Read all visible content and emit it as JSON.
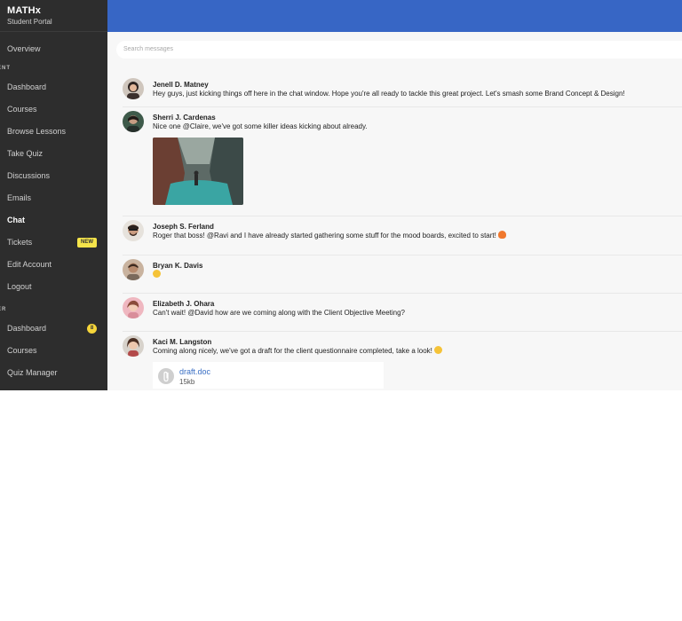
{
  "brand": {
    "name": "MATHx",
    "subtitle": "Student Portal"
  },
  "sidebar": {
    "overview": "Overview",
    "section_student": "ENT",
    "student_items": [
      {
        "label": "Dashboard"
      },
      {
        "label": "Courses"
      },
      {
        "label": "Browse Lessons"
      },
      {
        "label": "Take Quiz"
      },
      {
        "label": "Discussions"
      },
      {
        "label": "Emails"
      },
      {
        "label": "Chat"
      },
      {
        "label": "Tickets",
        "badge": "NEW"
      },
      {
        "label": "Edit Account"
      },
      {
        "label": "Logout"
      }
    ],
    "section_instructor": "ER",
    "instructor_items": [
      {
        "label": "Dashboard",
        "badge": "8"
      },
      {
        "label": "Courses"
      },
      {
        "label": "Quiz Manager"
      }
    ]
  },
  "search": {
    "placeholder": "Search messages"
  },
  "messages": [
    {
      "name": "Jenell D. Matney",
      "text": "Hey guys, just kicking things off here in the chat window. Hope you're all ready to tackle this great project. Let's smash some Brand Concept & Design!"
    },
    {
      "name": "Sherri J. Cardenas",
      "text": "Nice one @Claire, we've got some killer ideas kicking about already."
    },
    {
      "name": "Joseph S. Ferland",
      "text": "Roger that boss! @Ravi and I have already started gathering some stuff for the mood boards, excited to start!"
    },
    {
      "name": "Bryan K. Davis",
      "text": ""
    },
    {
      "name": "Elizabeth J. Ohara",
      "text": "Can't wait! @David how are we coming along with the Client Objective Meeting?"
    },
    {
      "name": "Kaci M. Langston",
      "text": "Coming along nicely, we've got a draft for the client questionnaire completed, take a look!"
    }
  ],
  "attachment": {
    "name": "draft.doc",
    "size": "15kb"
  },
  "colors": {
    "sidebar": "#2d2d2d",
    "topbar": "#3766c5",
    "link": "#3a6fc4",
    "badge": "#f5e44a"
  }
}
